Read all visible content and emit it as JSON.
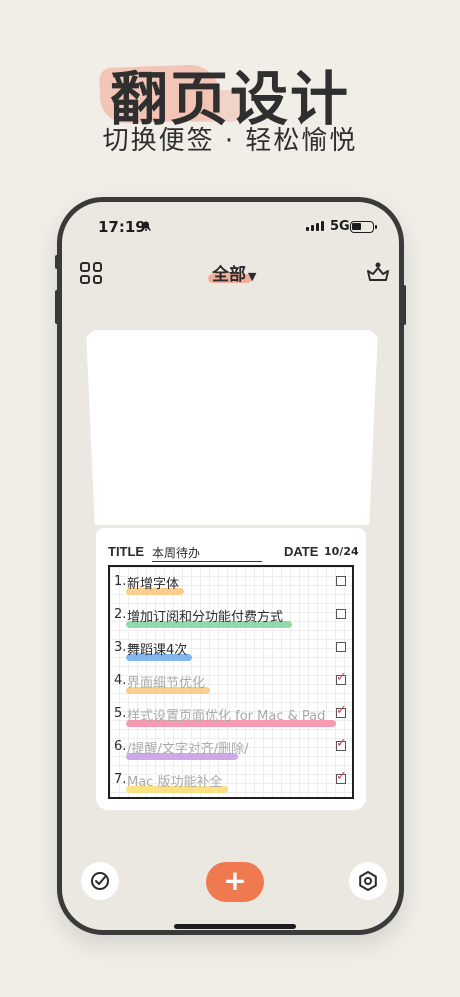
{
  "hero": {
    "title": "翻页设计",
    "subtitle": "切换便签 · 轻松愉悦"
  },
  "status_bar": {
    "time": "17:19",
    "network": "5G"
  },
  "nav": {
    "filter_label": "全部"
  },
  "note": {
    "title_label": "TITLE",
    "title_value": "本周待办",
    "date_label": "DATE",
    "date_value": "10/24",
    "items": [
      {
        "num": "1.",
        "text": "新增字体",
        "done": false,
        "color": "#f8c67a"
      },
      {
        "num": "2.",
        "text": "增加订阅和分功能付费方式",
        "done": false,
        "color": "#7fd49a"
      },
      {
        "num": "3.",
        "text": "舞蹈课4次",
        "done": false,
        "color": "#6fa9ec"
      },
      {
        "num": "4.",
        "text": "界面细节优化",
        "done": true,
        "color": "#f8c67a"
      },
      {
        "num": "5.",
        "text": "样式设置页面优化 for Mac & Pad",
        "done": true,
        "color": "#f58aa6"
      },
      {
        "num": "6.",
        "text": "/提醒/文字对齐/删除/",
        "done": true,
        "color": "#c89be4"
      },
      {
        "num": "7.",
        "text": "Mac 版功能补全",
        "done": true,
        "color": "#f7dd6e"
      }
    ]
  },
  "colors": {
    "accent": "#f07a4f",
    "background": "#f1eee8",
    "check_tick": "#d64545"
  },
  "icons": {
    "nav_left": "grid-icon",
    "nav_right": "crown-icon",
    "bottom_left": "check-circle-icon",
    "bottom_center": "plus-icon",
    "bottom_right": "settings-icon"
  }
}
